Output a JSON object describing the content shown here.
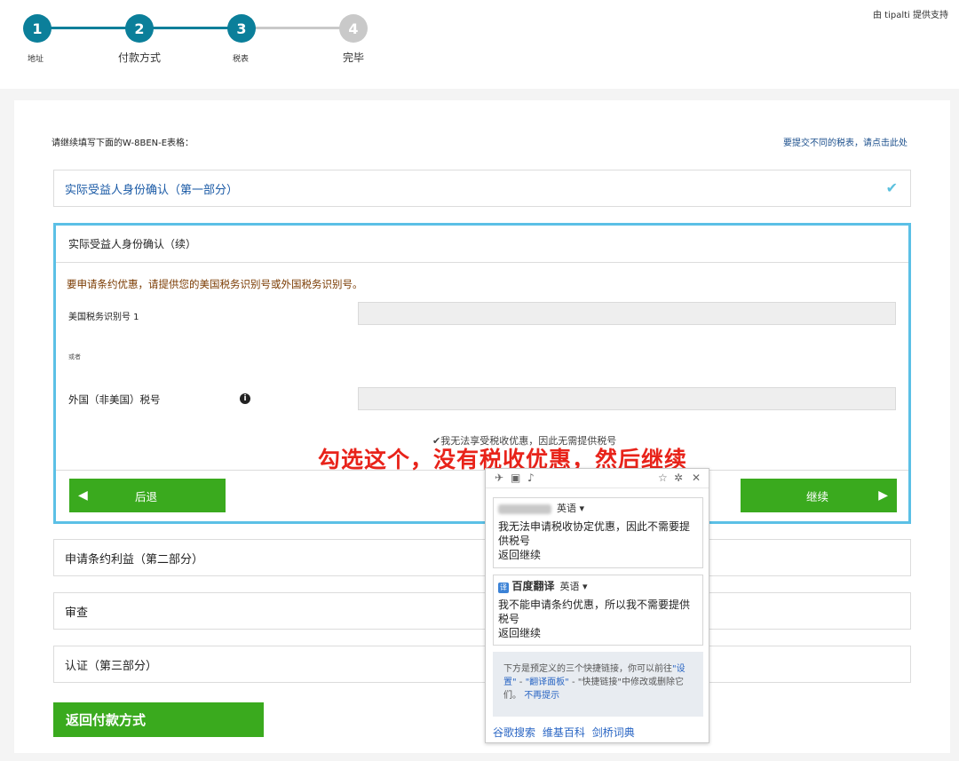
{
  "header": {
    "powered_by": "由 tipalti 提供支持"
  },
  "stepper": {
    "steps": [
      {
        "number": "1",
        "label": "地址",
        "state": "done"
      },
      {
        "number": "2",
        "label": "付款方式",
        "state": "done"
      },
      {
        "number": "3",
        "label": "税表",
        "state": "done"
      },
      {
        "number": "4",
        "label": "完毕",
        "state": "todo"
      }
    ]
  },
  "form": {
    "intro": "请继续填写下面的W-8BEN-E表格：",
    "other_form_link": "要提交不同的税表，请点击此处",
    "sections": {
      "part1": "实际受益人身份确认（第一部分）",
      "part2": "申请条约利益（第二部分）",
      "review": "审查",
      "part3": "认证（第三部分）"
    },
    "active": {
      "title": "实际受益人身份确认（续）",
      "instruction": "要申请条约优惠，请提供您的美国税务识别号或外国税务识别号。",
      "us_tin_label": "美国税务识别号 1",
      "or_label": "或者",
      "foreign_tin_label": "外国（非美国）税号",
      "us_tin_value": "",
      "foreign_tin_value": "",
      "no_treaty": "✔我无法享受税收优惠，因此无需提供税号",
      "back_button": "后退",
      "next_button": "继续"
    },
    "return_button": "返回付款方式"
  },
  "annotation": "勾选这个，没有税收优惠，然后继续",
  "translator": {
    "engine1": {
      "lang": "英语 ▾",
      "line1": "我无法申请税收协定优惠，因此不需要提供税号",
      "line2": "返回继续"
    },
    "engine2": {
      "name": "百度翻译",
      "badge": "译",
      "lang": "英语 ▾",
      "line1": "我不能申请条约优惠，所以我不需要提供税号",
      "line2": "返回继续"
    },
    "hint": {
      "pre": "下方是预定义的三个快捷链接，你可以前往",
      "settings_link": "\"设置\"",
      "sep1": " - ",
      "panel_link": "\"翻译面板\"",
      "post": " - \"快捷链接\"中修改或删除它们。",
      "dismiss_link": "不再提示"
    },
    "quick_links": [
      "谷歌搜索",
      "维基百科",
      "剑桥词典"
    ]
  },
  "colors": {
    "step_done": "#0b7f9a",
    "step_todo": "#c9c9c9",
    "button_green": "#3aaa1e",
    "panel_border": "#5bc0e6",
    "annotation_red": "#e8231a"
  }
}
